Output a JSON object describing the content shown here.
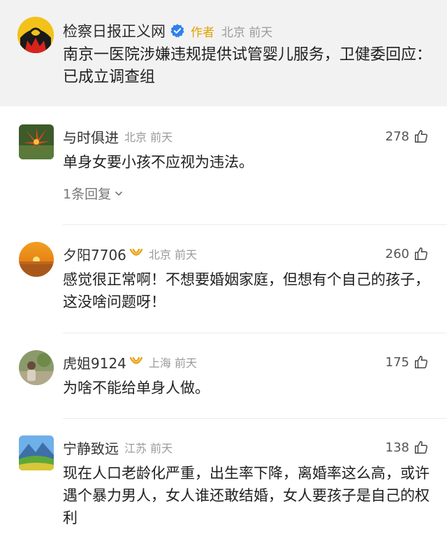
{
  "post": {
    "account": "检察日报正义网",
    "author_tag": "作者",
    "meta": "北京 前天",
    "title": "南京一医院涉嫌违规提供试管婴儿服务，卫健委回应：已成立调查组"
  },
  "comments": [
    {
      "user": "与时俱进",
      "meta": "北京 前天",
      "likes": "278",
      "text": "单身女要小孩不应视为违法。",
      "replies": "1条回复"
    },
    {
      "user": "夕阳7706",
      "meta": "北京 前天",
      "likes": "260",
      "text": "感觉很正常啊！不想要婚姻家庭，但想有个自己的孩子，这没啥问题呀！"
    },
    {
      "user": "虎姐9124",
      "meta": "上海 前天",
      "likes": "175",
      "text": "为啥不能给单身人做。"
    },
    {
      "user": "宁静致远",
      "meta": "江苏 前天",
      "likes": "138",
      "text": "现在人口老龄化严重，出生率下降，离婚率这么高，或许遇个暴力男人，女人谁还敢结婚，女人要孩子是自己的权利"
    }
  ],
  "colors": {
    "post_background": "#f2f2f2",
    "author_tag": "#e0a100",
    "verified": "#2f80ed",
    "meta_gray": "#9a9a9a"
  },
  "icons": {
    "verified": "verified-check-icon",
    "vip": "vip-badge-icon",
    "like": "thumbs-up-icon",
    "expand": "chevron-down-icon"
  }
}
